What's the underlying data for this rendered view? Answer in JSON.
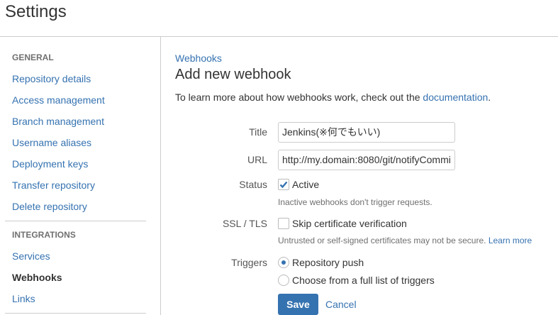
{
  "header": {
    "title": "Settings"
  },
  "sidebar": {
    "sections": [
      {
        "heading": "GENERAL",
        "items": [
          "Repository details",
          "Access management",
          "Branch management",
          "Username aliases",
          "Deployment keys",
          "Transfer repository",
          "Delete repository"
        ]
      },
      {
        "heading": "INTEGRATIONS",
        "items": [
          "Services",
          "Webhooks",
          "Links"
        ]
      }
    ],
    "active": "Webhooks"
  },
  "main": {
    "breadcrumb": "Webhooks",
    "heading": "Add new webhook",
    "intro": "To learn more about how webhooks work, check out the ",
    "intro_link": "documentation",
    "intro_end": ".",
    "form": {
      "title_label": "Title",
      "title_value": "Jenkins(※何でもいい)",
      "url_label": "URL",
      "url_value": "http://my.domain:8080/git/notifyCommi",
      "status_label": "Status",
      "status_option": "Active",
      "status_checked": true,
      "status_help": "Inactive webhooks don't trigger requests.",
      "ssl_label": "SSL / TLS",
      "ssl_option": "Skip certificate verification",
      "ssl_checked": false,
      "ssl_help": "Untrusted or self-signed certificates may not be secure. ",
      "ssl_help_link": "Learn more",
      "triggers_label": "Triggers",
      "trigger_options": [
        "Repository push",
        "Choose from a full list of triggers"
      ],
      "trigger_selected": 0,
      "save": "Save",
      "cancel": "Cancel"
    }
  }
}
